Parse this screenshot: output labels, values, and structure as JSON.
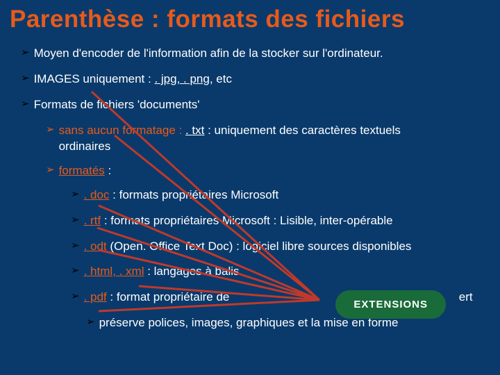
{
  "title": "Parenthèse : formats des fichiers",
  "bullets": {
    "encoder": "Moyen d'encoder de l'information afin de la stocker sur l'ordinateur.",
    "images_prefix": "IMAGES uniquement : ",
    "images_ext": ". jpg, . png,",
    "images_suffix": " etc",
    "formats_doc": "Formats de fichiers 'documents'",
    "sans_format_prefix": "sans aucun formatage : ",
    "txt_ext": ". txt",
    "sans_format_suffix": " : uniquement des caractères textuels ordinaires",
    "formates_prefix": "formatés",
    "formates_suffix": " :",
    "doc_ext": ". doc",
    "doc_suffix": " : formats propriétaires Microsoft",
    "rtf_ext": ". rtf",
    "rtf_suffix": " : formats propriétaires Microsoft : Lisible, inter-opérable",
    "odt_ext": ". odt",
    "odt_mid": " (Open. Office Text Doc) : logiciel libre sources disponibles",
    "html_ext": ". html, . xml",
    "html_suffix": " : langages à balis",
    "pdf_ext": ". pdf",
    "pdf_suffix": " : format propriétaire de",
    "pdf_tail": "ert",
    "preserve": "préserve polices, images, graphiques et la mise en forme"
  },
  "badge": "EXTENSIONS"
}
